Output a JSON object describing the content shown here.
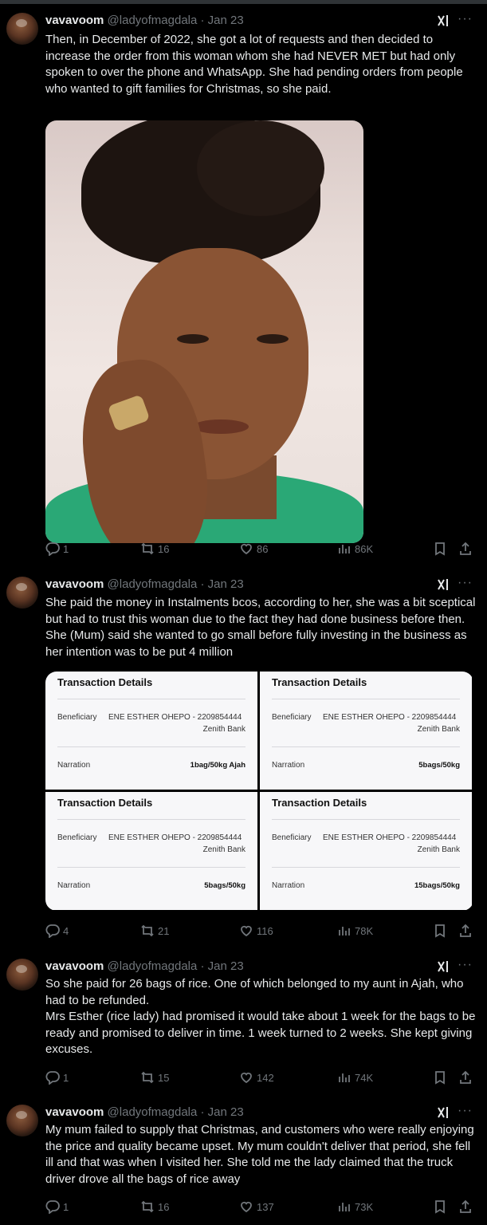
{
  "tweets": [
    {
      "name": "vavavoom",
      "handle": "@ladyofmagdala",
      "date": "· Jan 23",
      "text": "Then, in December of 2022, she got a lot of requests and then decided to increase the order from this woman whom she had NEVER MET but had only spoken to over the phone and WhatsApp. She had pending orders from people who wanted to gift families for Christmas, so she paid.",
      "replies": "1",
      "retweets": "16",
      "likes": "86",
      "views": "86K"
    },
    {
      "name": "vavavoom",
      "handle": "@ladyofmagdala",
      "date": "· Jan 23",
      "text": "She paid the money in Instalments bcos, according to her, she was a bit sceptical but had to trust this woman due to the fact they had done business before then. She (Mum) said she wanted to go small before fully investing in the business as her intention was to be put 4 million",
      "replies": "4",
      "retweets": "21",
      "likes": "116",
      "views": "78K"
    },
    {
      "name": "vavavoom",
      "handle": "@ladyofmagdala",
      "date": "· Jan 23",
      "text": "So she paid for 26 bags of rice. One of which belonged to my aunt in Ajah, who had to be refunded.\nMrs Esther (rice lady) had promised it would take about 1 week for the bags to be ready and promised to deliver in time. 1 week turned to 2 weeks. She kept giving excuses.",
      "replies": "1",
      "retweets": "15",
      "likes": "142",
      "views": "74K"
    },
    {
      "name": "vavavoom",
      "handle": "@ladyofmagdala",
      "date": "· Jan 23",
      "text": "My mum failed to supply that Christmas, and customers who were really enjoying the price and quality became upset. My mum couldn't deliver that period, she fell ill and that was when I visited her. She told me the lady claimed that the truck driver drove all the bags of rice away",
      "replies": "1",
      "retweets": "16",
      "likes": "137",
      "views": "73K"
    }
  ],
  "transactions": [
    {
      "title": "Transaction Details",
      "beneficiary_label": "Beneficiary",
      "beneficiary": "ENE ESTHER OHEPO - 2209854444",
      "bank": "Zenith Bank",
      "narration_label": "Narration",
      "narration": "1bag/50kg Ajah"
    },
    {
      "title": "Transaction Details",
      "beneficiary_label": "Beneficiary",
      "beneficiary": "ENE ESTHER OHEPO - 2209854444",
      "bank": "Zenith Bank",
      "narration_label": "Narration",
      "narration": "5bags/50kg"
    },
    {
      "title": "Transaction Details",
      "beneficiary_label": "Beneficiary",
      "beneficiary": "ENE ESTHER OHEPO - 2209854444",
      "bank": "Zenith Bank",
      "narration_label": "Narration",
      "narration": "5bags/50kg"
    },
    {
      "title": "Transaction Details",
      "beneficiary_label": "Beneficiary",
      "beneficiary": "ENE ESTHER OHEPO - 2209854444",
      "bank": "Zenith Bank",
      "narration_label": "Narration",
      "narration": "15bags/50kg"
    }
  ],
  "icons": {
    "reply": "reply-icon",
    "retweet": "retweet-icon",
    "like": "heart-icon",
    "views": "views-icon",
    "bookmark": "bookmark-icon",
    "share": "share-icon",
    "grok": "grok-icon",
    "more": "more-icon"
  },
  "colors": {
    "background": "#000000",
    "text": "#e7e9ea",
    "muted": "#71767b"
  }
}
